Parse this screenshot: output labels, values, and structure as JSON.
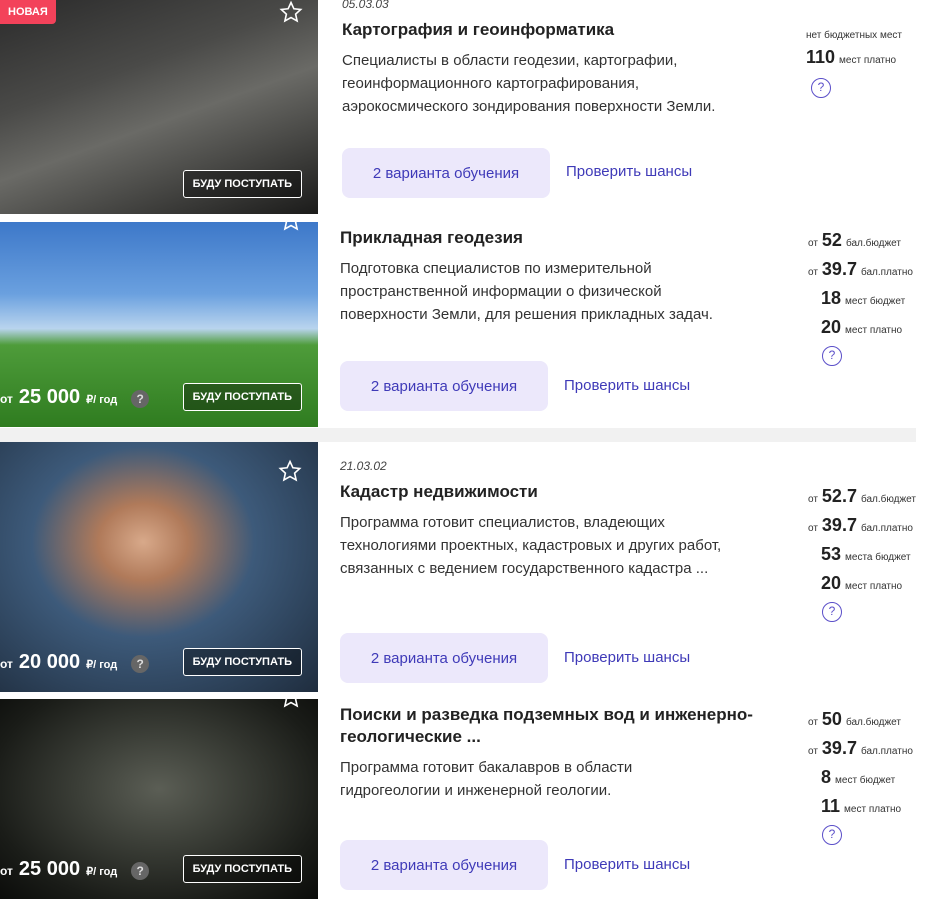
{
  "programs": [
    {
      "badge": "НОВАЯ",
      "code": "05.03.03",
      "title": "Картография и геоинформатика",
      "description": "Специалисты в области геодезии, картографии, геоинформационного картографирования, аэрокосмического зондирования поверхности Земли.",
      "apply_label": "БУДУ ПОСТУПАТЬ",
      "variants_label": "2 варианта обучения",
      "chances_label": "Проверить шансы",
      "stats_note": "нет бюджетных мест",
      "stats": [
        {
          "prefix": "",
          "value": "110",
          "label": "мест платно"
        }
      ],
      "help": "?"
    },
    {
      "code": "",
      "title": "Прикладная геодезия",
      "description": "Подготовка специалистов по измерительной пространственной информации о физической поверхности Земли, для решения прикладных задач.",
      "price_from": "от",
      "price": "25 000",
      "price_unit": "₽/ год",
      "price_help": "?",
      "apply_label": "БУДУ ПОСТУПАТЬ",
      "variants_label": "2 варианта обучения",
      "chances_label": "Проверить шансы",
      "stats": [
        {
          "prefix": "от",
          "value": "52",
          "label": "бал.бюджет"
        },
        {
          "prefix": "от",
          "value": "39.7",
          "label": "бал.платно"
        },
        {
          "prefix": "",
          "value": "18",
          "label": "мест бюджет"
        },
        {
          "prefix": "",
          "value": "20",
          "label": "мест платно"
        }
      ],
      "help": "?"
    },
    {
      "code": "21.03.02",
      "title": "Кадастр недвижимости",
      "description": "Программа готовит специалистов, владеющих технологиями проектных, кадастровых и других работ, связанных с ведением государственного кадастра ...",
      "price_from": "от",
      "price": "20 000",
      "price_unit": "₽/ год",
      "price_help": "?",
      "apply_label": "БУДУ ПОСТУПАТЬ",
      "variants_label": "2 варианта обучения",
      "chances_label": "Проверить шансы",
      "stats": [
        {
          "prefix": "от",
          "value": "52.7",
          "label": "бал.бюджет"
        },
        {
          "prefix": "от",
          "value": "39.7",
          "label": "бал.платно"
        },
        {
          "prefix": "",
          "value": "53",
          "label": "места бюджет"
        },
        {
          "prefix": "",
          "value": "20",
          "label": "мест платно"
        }
      ],
      "help": "?"
    },
    {
      "code": "",
      "title": "Поиски и разведка подземных вод и инженерно-геологические ...",
      "description": "Программа готовит бакалавров в области гидрогеологии и инженерной геологии.",
      "price_from": "от",
      "price": "25 000",
      "price_unit": "₽/ год",
      "price_help": "?",
      "apply_label": "БУДУ ПОСТУПАТЬ",
      "variants_label": "2 варианта обучения",
      "chances_label": "Проверить шансы",
      "stats": [
        {
          "prefix": "от",
          "value": "50",
          "label": "бал.бюджет"
        },
        {
          "prefix": "от",
          "value": "39.7",
          "label": "бал.платно"
        },
        {
          "prefix": "",
          "value": "8",
          "label": "мест бюджет"
        },
        {
          "prefix": "",
          "value": "11",
          "label": "мест платно"
        }
      ],
      "help": "?"
    }
  ]
}
